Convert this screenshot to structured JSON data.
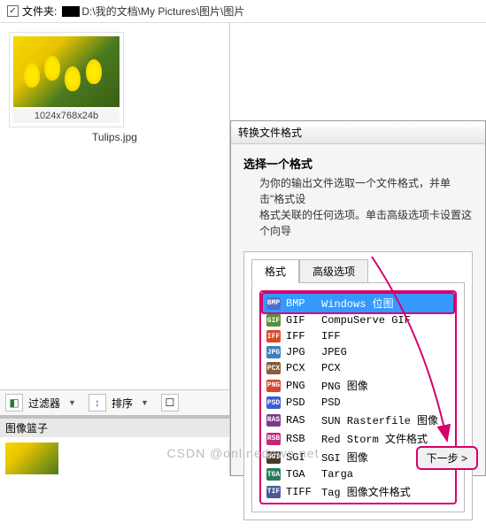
{
  "pathbar": {
    "label": "文件夹:",
    "path": "D:\\我的文档\\My Pictures\\图片\\图片"
  },
  "thumbnail": {
    "dimensions": "1024x768x24b",
    "filename": "Tulips.jpg"
  },
  "bottombar": {
    "filter_label": "过滤器",
    "sort_label": "排序"
  },
  "basket": {
    "title": "图像篮子"
  },
  "dialog": {
    "title": "转换文件格式",
    "heading": "选择一个格式",
    "description_line1": "为你的输出文件选取一个文件格式，并单击\"格式设",
    "description_line2": "格式关联的任何选项。单击高级选项卡设置这个向导",
    "tab_format": "格式",
    "tab_advanced": "高级选项",
    "next_button": "下一步 >"
  },
  "formats": [
    {
      "ext": "BMP",
      "desc": "Windows 位图",
      "color": "#4a6fd4",
      "selected": true
    },
    {
      "ext": "GIF",
      "desc": "CompuServe GIF",
      "color": "#5a8f3a",
      "selected": false
    },
    {
      "ext": "IFF",
      "desc": "IFF",
      "color": "#d84a2a",
      "selected": false
    },
    {
      "ext": "JPG",
      "desc": "JPEG",
      "color": "#3a7fbf",
      "selected": false
    },
    {
      "ext": "PCX",
      "desc": "PCX",
      "color": "#8a5a3a",
      "selected": false
    },
    {
      "ext": "PNG",
      "desc": "PNG 图像",
      "color": "#d8442a",
      "selected": false
    },
    {
      "ext": "PSD",
      "desc": "PSD",
      "color": "#3a5fd4",
      "selected": false
    },
    {
      "ext": "RAS",
      "desc": "SUN Rasterfile 图像",
      "color": "#7a3a8a",
      "selected": false
    },
    {
      "ext": "RSB",
      "desc": "Red Storm 文件格式",
      "color": "#c4287a",
      "selected": false
    },
    {
      "ext": "SGI",
      "desc": "SGI 图像",
      "color": "#4a3a2a",
      "selected": false
    },
    {
      "ext": "TGA",
      "desc": "Targa",
      "color": "#2a7a5a",
      "selected": false
    },
    {
      "ext": "TIFF",
      "desc": "Tag 图像文件格式",
      "color": "#4a5a9a",
      "selected": false
    }
  ],
  "watermark": "CSDN @onlinedown.net",
  "annotation": {
    "arrow_color": "#d6006e"
  }
}
